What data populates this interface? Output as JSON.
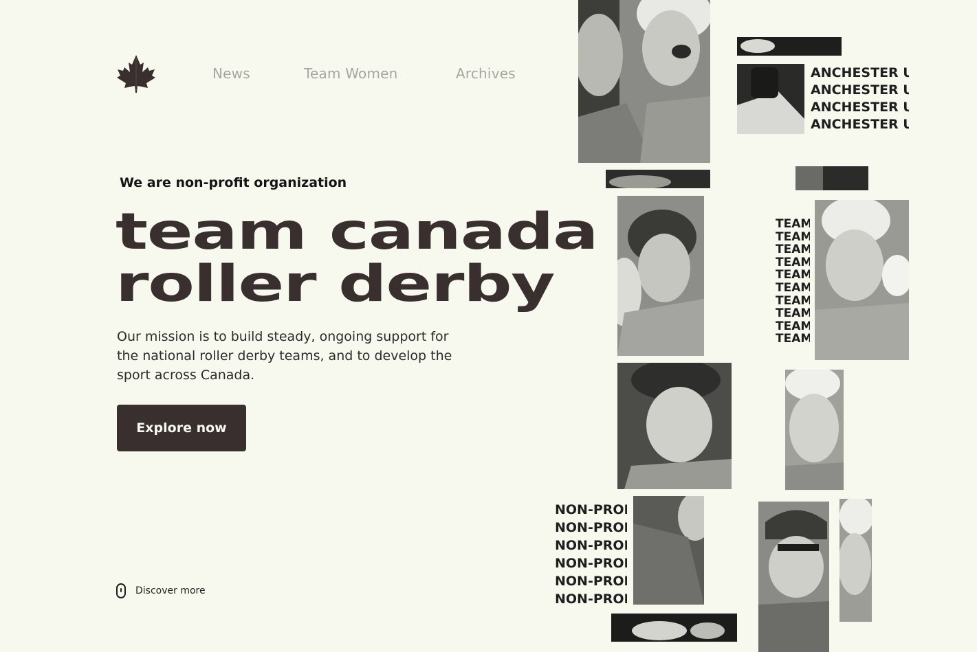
{
  "nav": {
    "items": [
      "News",
      "Team Women",
      "Archives"
    ]
  },
  "logo": {
    "icon": "maple-leaf-icon",
    "color": "#3a2f2f"
  },
  "hero": {
    "eyebrow": "We are non-profit organization",
    "title_line1": "team canada",
    "title_line2": "roller derby",
    "mission": "Our mission is to build steady, ongoing support for the national roller derby teams, and to develop the sport across Canada.",
    "cta_label": "Explore now"
  },
  "discover": {
    "label": "Discover more",
    "icon": "mouse-scroll-icon"
  },
  "collage": {
    "repeat_manchester": "ANCHESTER UK",
    "repeat_team": "TEAM",
    "repeat_nonprofit": "NON-PROF"
  },
  "colors": {
    "background": "#f7f9ef",
    "primary": "#3a2f2f",
    "nav_text": "#a6a6a0"
  }
}
